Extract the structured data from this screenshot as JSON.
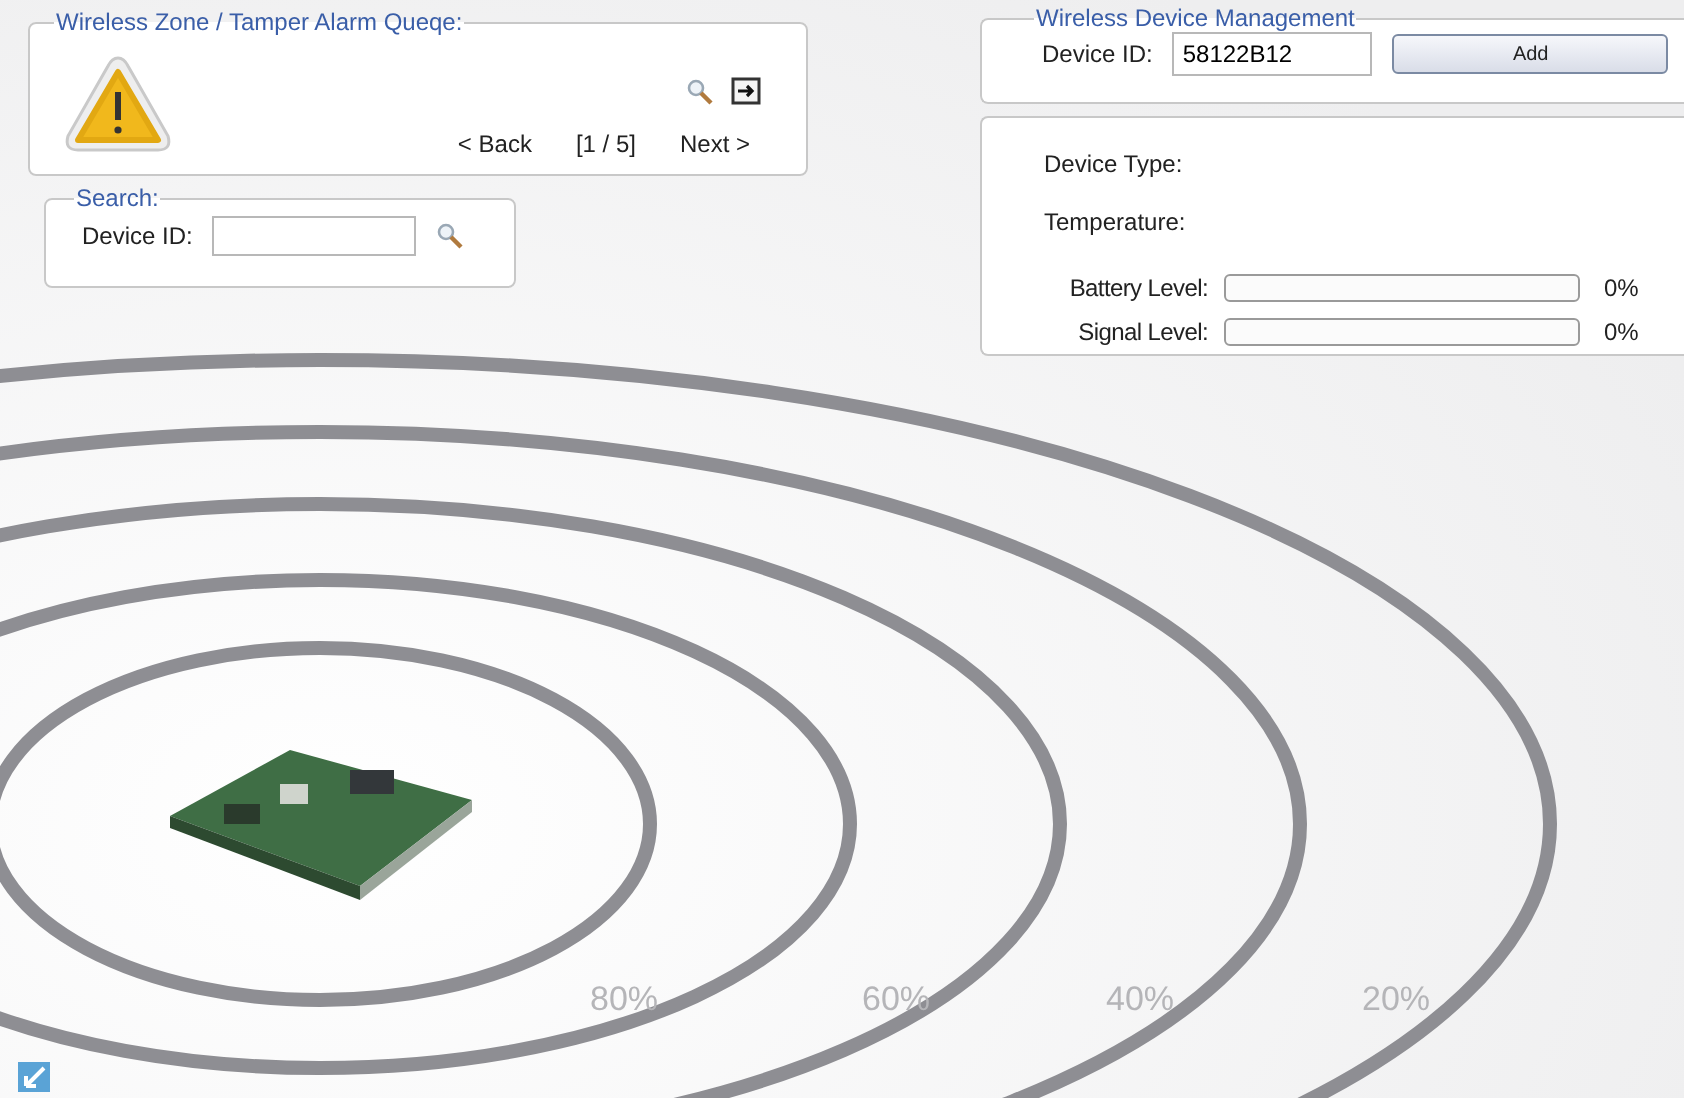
{
  "alarm_queue": {
    "title": "Wireless Zone / Tamper Alarm Queqe:",
    "back": "< Back",
    "page": "[1 / 5]",
    "next": "Next >"
  },
  "search": {
    "title": "Search:",
    "label": "Device ID:"
  },
  "device_management": {
    "title": "Wireless Device Management",
    "label": "Device ID:",
    "value": "58122B12",
    "button": "Add"
  },
  "device_info": {
    "fields": [
      {
        "label": "Device Type:"
      },
      {
        "label": "Temperature:"
      }
    ],
    "meters": [
      {
        "label": "Battery Level:",
        "level": 0,
        "reading": "0%"
      },
      {
        "label": "Signal Level:",
        "level": 0,
        "reading": "0%"
      }
    ]
  },
  "range_rings": [
    "80%",
    "60%",
    "40%",
    "20%"
  ]
}
